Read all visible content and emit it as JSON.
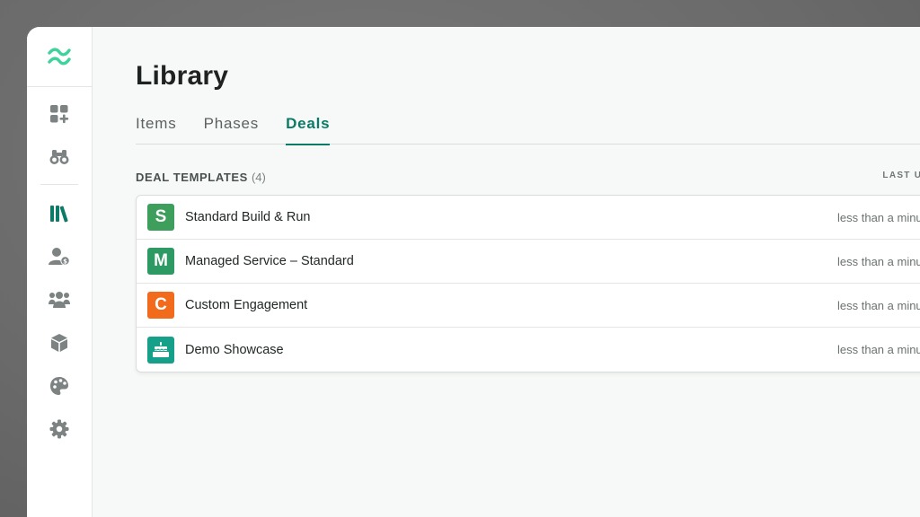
{
  "sidebar": {
    "logo": "wave-logo",
    "top_items": [
      {
        "name": "dashboard-add-icon"
      },
      {
        "name": "binoculars-icon"
      }
    ],
    "bottom_items": [
      {
        "name": "library-icon",
        "active": true
      },
      {
        "name": "user-billing-icon"
      },
      {
        "name": "team-icon"
      },
      {
        "name": "cube-icon"
      },
      {
        "name": "palette-icon"
      },
      {
        "name": "gear-icon"
      }
    ],
    "accent": "#0b7a66",
    "icon_color": "#7c8382"
  },
  "page": {
    "title": "Library",
    "tabs": [
      {
        "label": "Items",
        "active": false
      },
      {
        "label": "Phases",
        "active": false
      },
      {
        "label": "Deals",
        "active": true
      }
    ]
  },
  "deal_templates": {
    "title": "DEAL TEMPLATES",
    "count": "(4)",
    "column_header": "LAST UPDAT",
    "rows": [
      {
        "badge": "S",
        "badge_color": "#3e9e5c",
        "name": "Standard Build & Run",
        "updated": "less than a minu"
      },
      {
        "badge": "M",
        "badge_color": "#2e9a63",
        "name": "Managed Service – Standard",
        "updated": "less than a minu"
      },
      {
        "badge": "C",
        "badge_color": "#f26b1d",
        "name": "Custom Engagement",
        "updated": "less than a minu"
      },
      {
        "badge": "",
        "badge_icon": "cake-icon",
        "badge_color": "#16a08a",
        "name": "Demo Showcase",
        "updated": "less than a minu"
      }
    ]
  }
}
